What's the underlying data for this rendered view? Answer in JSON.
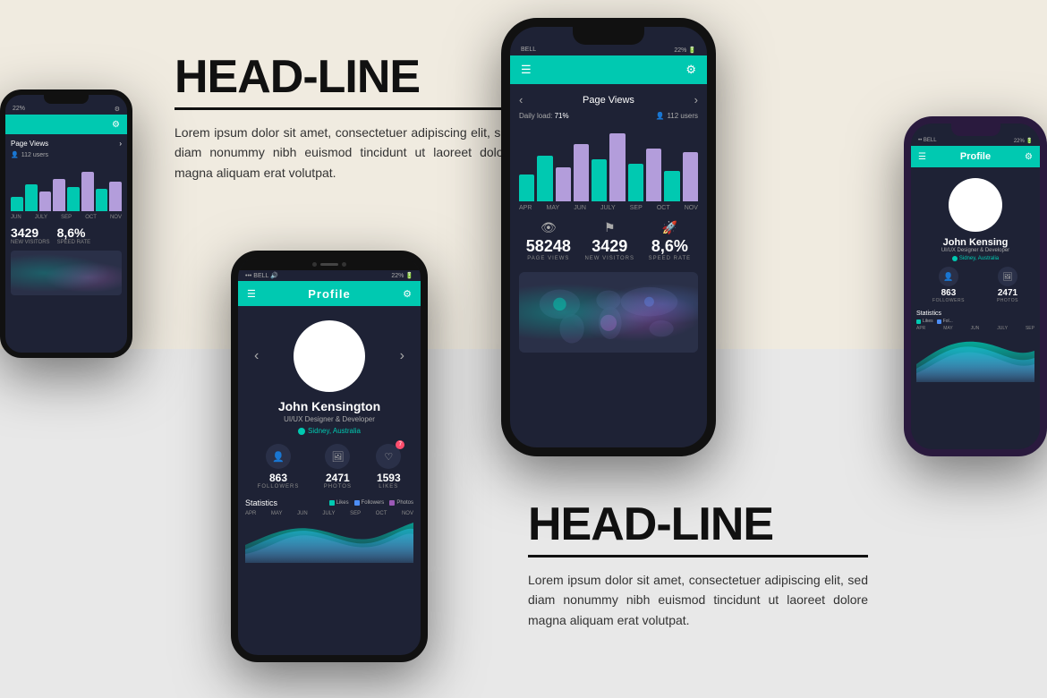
{
  "backgrounds": {
    "top_color": "#f0ebe0",
    "bottom_color": "#e8e8e8"
  },
  "headline_top": {
    "title": "HEAD-LINE",
    "body": "Lorem ipsum dolor sit amet, consectetuer adipiscing elit, sed diam nonummy nibh euismod tincidunt ut laoreet dolore magna aliquam erat volutpat."
  },
  "headline_bottom": {
    "title": "HEAD-LINE",
    "body": "Lorem ipsum dolor sit amet, consectetuer adipiscing elit, sed diam nonummy nibh euismod tincidunt ut laoreet dolore magna aliquam erat volutpat."
  },
  "phone1": {
    "status_left": "22%",
    "page_views_label": "Page Views",
    "users": "112 users",
    "months": [
      "JUN",
      "JULY",
      "SEP",
      "OCT",
      "NOV"
    ],
    "stat1_val": "3429",
    "stat1_lbl": "NEW VISITORS",
    "stat2_val": "8,6%",
    "stat2_lbl": "SPEED RATE"
  },
  "phone2": {
    "status_left": "BELL",
    "status_right": "22%",
    "header_title": "Profile",
    "name": "John Kensington",
    "role": "UI/UX Designer & Developer",
    "location": "Sidney, Australia",
    "followers": "863",
    "followers_lbl": "FOLLOWERS",
    "photos": "2471",
    "photos_lbl": "PHOTOS",
    "likes": "1593",
    "likes_lbl": "LIKES",
    "likes_badge": "7",
    "stats_label": "Statistics",
    "legend": [
      {
        "label": "Likes",
        "color": "#00c9b1"
      },
      {
        "label": "Followers",
        "color": "#4d8ef7"
      },
      {
        "label": "Photos",
        "color": "#9b59b6"
      }
    ],
    "months": [
      "APR",
      "MAY",
      "JUN",
      "JULY",
      "SEP",
      "OCT",
      "NOV"
    ]
  },
  "phone3": {
    "status_left": "BELL",
    "status_right": "22%",
    "page_views_label": "Page Views",
    "daily_load": "71%",
    "users": "112 users",
    "months": [
      "APR",
      "MAY",
      "JUN",
      "JULY",
      "SEP",
      "OCT",
      "NOV"
    ],
    "stat1_icon": "👁",
    "stat1_val": "58248",
    "stat1_lbl": "PAGE VIEWS",
    "stat2_icon": "🚩",
    "stat2_val": "3429",
    "stat2_lbl": "NEW VISITORS",
    "stat3_icon": "🚀",
    "stat3_val": "8,6%",
    "stat3_lbl": "SPEED RATE"
  },
  "phone4": {
    "status_left": "BELL",
    "status_right": "22%",
    "header_title": "Profile",
    "name": "John Kensing",
    "role": "UI/UX Designer & Developer",
    "location": "Sidney, Australia",
    "followers": "863",
    "followers_lbl": "FOLLOWERS",
    "photos": "2471",
    "photos_lbl": "PHOTOS",
    "stats_label": "Statistics",
    "legend": [
      {
        "label": "Likes",
        "color": "#00c9b1"
      },
      {
        "label": "Fol...",
        "color": "#4d8ef7"
      }
    ],
    "months": [
      "APR",
      "MAY",
      "JUN",
      "JULY",
      "SEP"
    ]
  },
  "colors": {
    "teal": "#00c9b1",
    "dark_bg": "#1e2235",
    "dark_card": "#2a3048",
    "bar_teal": "#00c9b1",
    "bar_purple": "#b39ddb",
    "bar_blue": "#4d8ef7"
  }
}
